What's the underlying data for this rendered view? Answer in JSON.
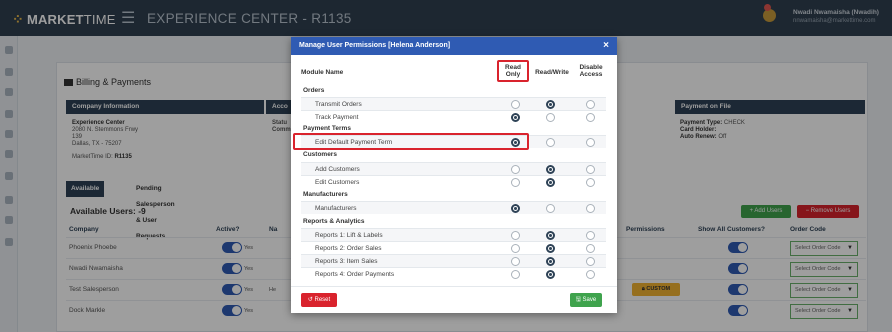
{
  "app": {
    "logo_mark": "⁘",
    "logo_bold": "MARKET",
    "logo_light": "TIME",
    "menu_icon": "☰",
    "title": "EXPERIENCE CENTER - R1135",
    "user_name": "Nwadi Nwamaisha (Nwadih)",
    "user_email": "nnwamaisha@markettime.com"
  },
  "page": {
    "section_title": "Billing & Payments",
    "company_info_header": "Company Information",
    "account_header": "Acco",
    "status_line1": "Statu",
    "status_line2": "Comm",
    "company_name": "Experience Center",
    "address1": "2080 N. Stemmons Frwy",
    "address2": "139",
    "address3": "Dallas, TX - 75207",
    "markettime_id_label": "MarketTime ID:",
    "markettime_id": "R1135",
    "payment_header": "Payment on File",
    "payment_type_label": "Payment Type:",
    "payment_type": "CHECK",
    "card_holder_label": "Card Holder:",
    "auto_renew_label": "Auto Renew:",
    "auto_renew": "Off",
    "tabs": [
      "Available Users",
      "Pending Salesperson & User Requests"
    ],
    "available_users": "Available Users: -9",
    "add_users": "+ Add Users",
    "remove_users": "− Remove Users"
  },
  "users_table": {
    "headers": {
      "company": "Company",
      "active": "Active?",
      "name": "Na",
      "permissions": "Permissions",
      "show_all": "Show All Customers?",
      "order_code": "Order Code"
    },
    "rows": [
      {
        "company": "Phoenix Phoebe",
        "active": "Yes",
        "mid": "",
        "custom": "",
        "order_code": "Select Order Code"
      },
      {
        "company": "Nwadi Nwamaisha",
        "active": "Yes",
        "mid": "",
        "custom": "",
        "order_code": "Select Order Code"
      },
      {
        "company": "Test Salesperson",
        "active": "Yes",
        "mid": "He",
        "custom": "CUSTOM",
        "order_code": "Select Order Code"
      },
      {
        "company": "Dock Markle",
        "active": "Yes",
        "mid": "",
        "custom": "",
        "order_code": "Select Order Code"
      }
    ]
  },
  "modal": {
    "title": "Manage User Permissions [Helena Anderson]",
    "close": "×",
    "col_module": "Module Name",
    "col_read1": "Read",
    "col_read2": "Only",
    "col_readwrite": "Read/Write",
    "col_disable1": "Disable",
    "col_disable2": "Access",
    "groups": {
      "orders": "Orders",
      "payment_terms": "Payment Terms",
      "customers": "Customers",
      "manufacturers": "Manufacturers",
      "reports": "Reports & Analytics"
    },
    "items": [
      {
        "label": "Transmit Orders",
        "selected": "readwrite"
      },
      {
        "label": "Track Payment",
        "selected": "read"
      },
      {
        "label": "Edit Default Payment Term",
        "selected": "read"
      },
      {
        "label": "Add Customers",
        "selected": "readwrite"
      },
      {
        "label": "Edit Customers",
        "selected": "readwrite"
      },
      {
        "label": "Manufacturers",
        "selected": "read"
      },
      {
        "label": "Reports 1: Lift & Labels",
        "selected": "readwrite"
      },
      {
        "label": "Reports 2: Order Sales",
        "selected": "readwrite"
      },
      {
        "label": "Reports 3: Item Sales",
        "selected": "readwrite"
      },
      {
        "label": "Reports 4: Order Payments",
        "selected": "readwrite"
      }
    ],
    "reset": "↺ Reset",
    "save": "🖫 Save"
  },
  "colors": {
    "topbar": "#2f3f4f",
    "modal_header": "#2f5bb3",
    "highlight": "#d9232d",
    "reset": "#d9232d",
    "save": "#3fa34d"
  }
}
